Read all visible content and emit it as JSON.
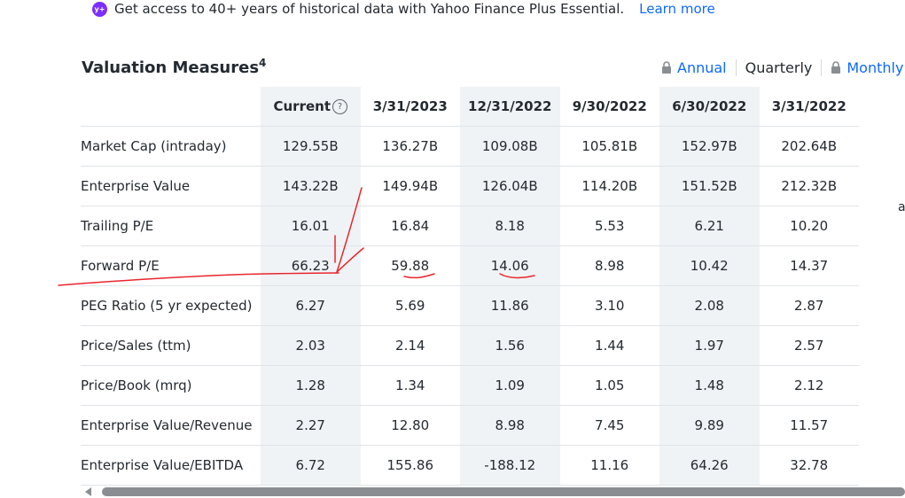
{
  "promo": {
    "badge": "y+",
    "text": "Get access to 40+ years of historical data with Yahoo Finance Plus Essential.",
    "link": "Learn more"
  },
  "section": {
    "title": "Valuation Measures",
    "footnote": "4"
  },
  "toggles": {
    "annual": "Annual",
    "quarterly": "Quarterly",
    "monthly": "Monthly"
  },
  "table": {
    "headers": [
      "Current",
      "3/31/2023",
      "12/31/2022",
      "9/30/2022",
      "6/30/2022",
      "3/31/2022"
    ],
    "rows": [
      {
        "label": "Market Cap (intraday)",
        "values": [
          "129.55B",
          "136.27B",
          "109.08B",
          "105.81B",
          "152.97B",
          "202.64B"
        ]
      },
      {
        "label": "Enterprise Value",
        "values": [
          "143.22B",
          "149.94B",
          "126.04B",
          "114.20B",
          "151.52B",
          "212.32B"
        ]
      },
      {
        "label": "Trailing P/E",
        "values": [
          "16.01",
          "16.84",
          "8.18",
          "5.53",
          "6.21",
          "10.20"
        ]
      },
      {
        "label": "Forward P/E",
        "values": [
          "66.23",
          "59.88",
          "14.06",
          "8.98",
          "10.42",
          "14.37"
        ]
      },
      {
        "label": "PEG Ratio (5 yr expected)",
        "values": [
          "6.27",
          "5.69",
          "11.86",
          "3.10",
          "2.08",
          "2.87"
        ]
      },
      {
        "label": "Price/Sales (ttm)",
        "values": [
          "2.03",
          "2.14",
          "1.56",
          "1.44",
          "1.97",
          "2.57"
        ]
      },
      {
        "label": "Price/Book (mrq)",
        "values": [
          "1.28",
          "1.34",
          "1.09",
          "1.05",
          "1.48",
          "2.12"
        ]
      },
      {
        "label": "Enterprise Value/Revenue",
        "values": [
          "2.27",
          "12.80",
          "8.98",
          "7.45",
          "9.89",
          "11.57"
        ]
      },
      {
        "label": "Enterprise Value/EBITDA",
        "values": [
          "6.72",
          "155.86",
          "-188.12",
          "11.16",
          "64.26",
          "32.78"
        ]
      }
    ]
  },
  "edge_char": "a",
  "colors": {
    "link_blue": "#0f69ff",
    "premium_purple": "#7d2eff",
    "annotation_red": "#e8262e",
    "shaded_column": "#f0f3f5"
  },
  "icons": [
    "lock-icon",
    "help-icon",
    "scroll-left-arrow-icon"
  ]
}
